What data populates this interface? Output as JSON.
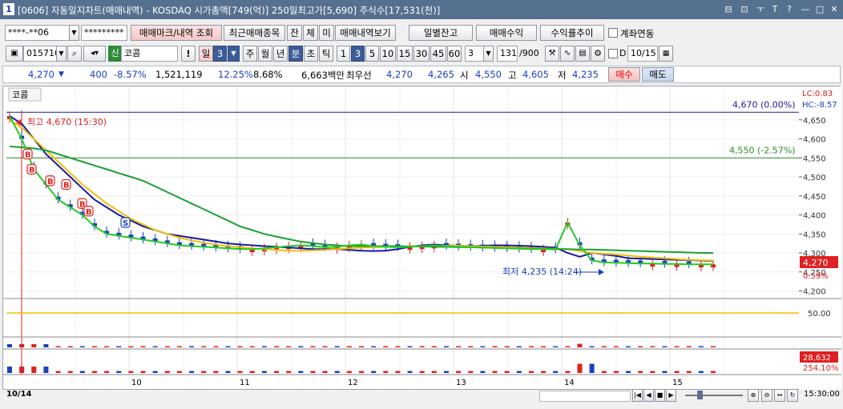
{
  "window": {
    "number": "1",
    "title": "[0606] 자동일지차트(매매내역) - KOSDAQ 시가총액[749(억)] 250일최고가[5,690] 주식수[17,531(천)]",
    "controls": [
      "⊟",
      "⊡",
      "ㅜ",
      "T",
      "?",
      "—",
      "□",
      "✕"
    ]
  },
  "toolbar1": {
    "account": "****-**06",
    "password": "*********",
    "buttons": {
      "trade_mark": "매매마크/내역 조회",
      "recent_items": "최근매매종목",
      "balance": "잔",
      "execution": "체",
      "unfilled": "미",
      "trade_history": "매매내역보기",
      "daily_balance": "일별잔고",
      "trade_profit": "매매수익",
      "return_trend": "수익률추이"
    },
    "account_link_label": "계좌연동"
  },
  "toolbar2": {
    "code": "015710",
    "market_tag": "신",
    "stock_name": "코콤",
    "period_unit": "일",
    "period_value": "3",
    "periods": [
      "주",
      "월",
      "년",
      "분",
      "초",
      "틱"
    ],
    "intervals": [
      "1",
      "3",
      "5",
      "10",
      "15",
      "30",
      "45",
      "60"
    ],
    "interval_value": "3",
    "count_current": "131",
    "count_total": "/900",
    "d_label": "D",
    "date": "10/15"
  },
  "quote": {
    "price": "4,270",
    "change": "400",
    "change_pct": "-8.57%",
    "volume": "1,521,119",
    "turnover_pct": "12.25%",
    "pct2": "8.68%",
    "amount": "6,663백만",
    "best_label": "최우선",
    "ask": "4,270",
    "bid": "4,265",
    "open_label": "시",
    "open": "4,550",
    "high_label": "고",
    "high": "4,605",
    "low_label": "저",
    "low": "4,235",
    "buy": "매수",
    "sell": "매도"
  },
  "chart_data": {
    "type": "line",
    "legend": "코콤",
    "ylim": [
      4180,
      4700
    ],
    "y_ticks": [
      "4,650",
      "4,600",
      "4,550",
      "4,500",
      "4,450",
      "4,400",
      "4,350",
      "4,300",
      "4,250",
      "4,200"
    ],
    "x_labels": [
      "10/14",
      "10",
      "11",
      "12",
      "13",
      "14",
      "15"
    ],
    "lc": "LC:0.83",
    "hc": "HC:-8.57",
    "hline_top": {
      "value": 4670,
      "label": "4,670 (0.00%)"
    },
    "hline_mid": {
      "value": 4550,
      "label": "4,550 (-2.57%)"
    },
    "high_annotation": "최고 4,670 (15:30)",
    "low_annotation": "최저 4,235 (14:24)",
    "current_price": "4,270",
    "current_pct": "0.59%",
    "osc_label": "50.00",
    "volume_label": "28,632",
    "volume_pct": "254.10%",
    "time_label": "15:30:00",
    "trade_marks": [
      "B",
      "B",
      "B",
      "B",
      "B",
      "B",
      "S"
    ],
    "series": [
      {
        "color": "#1818a8",
        "values": [
          4660,
          4640,
          4600,
          4560,
          4530,
          4500,
          4470,
          4440,
          4420,
          4400,
          4385,
          4370,
          4360,
          4350,
          4345,
          4340,
          4335,
          4330,
          4325,
          4322,
          4320,
          4318,
          4316,
          4314,
          4312,
          4310,
          4310,
          4310,
          4308,
          4306,
          4305,
          4306,
          4310,
          4316,
          4320,
          4322,
          4320,
          4319,
          4318,
          4319,
          4320,
          4320,
          4319,
          4318,
          4316,
          4314,
          4300,
          4290,
          4300,
          4296,
          4292,
          4286,
          4285,
          4284,
          4283,
          4282,
          4281,
          4280,
          4279
        ]
      },
      {
        "color": "#f0c000",
        "values": [
          4650,
          4630,
          4600,
          4570,
          4540,
          4510,
          4480,
          4455,
          4430,
          4410,
          4390,
          4375,
          4360,
          4350,
          4340,
          4333,
          4327,
          4322,
          4318,
          4315,
          4312,
          4310,
          4308,
          4306,
          4306,
          4307,
          4308,
          4310,
          4312,
          4314,
          4315,
          4316,
          4317,
          4318,
          4318,
          4318,
          4319,
          4319,
          4318,
          4317,
          4316,
          4315,
          4314,
          4313,
          4312,
          4311,
          4310,
          4305,
          4300,
          4298,
          4296,
          4293,
          4290,
          4288,
          4286,
          4284,
          4282,
          4281,
          4280
        ]
      },
      {
        "color": "#1aa030",
        "values": [
          4580,
          4578,
          4575,
          4570,
          4560,
          4550,
          4540,
          4530,
          4520,
          4510,
          4500,
          4490,
          4475,
          4460,
          4445,
          4430,
          4415,
          4400,
          4385,
          4370,
          4360,
          4350,
          4343,
          4336,
          4330,
          4326,
          4322,
          4320,
          4318,
          4318,
          4318,
          4318,
          4318,
          4317,
          4317,
          4316,
          4316,
          4315,
          4315,
          4314,
          4313,
          4312,
          4312,
          4311,
          4311,
          4310,
          4310,
          4309,
          4309,
          4308,
          4307,
          4306,
          4305,
          4304,
          4303,
          4302,
          4301,
          4300,
          4300
        ]
      }
    ],
    "fast_series": {
      "color": "#22cc22",
      "values": [
        4660,
        4600,
        4520,
        4480,
        4440,
        4420,
        4400,
        4370,
        4350,
        4345,
        4340,
        4335,
        4330,
        4325,
        4320,
        4318,
        4316,
        4314,
        4312,
        4310,
        4310,
        4312,
        4315,
        4318,
        4320,
        4318,
        4315,
        4316,
        4320,
        4322,
        4318,
        4316,
        4315,
        4316,
        4318,
        4320,
        4318,
        4316,
        4315,
        4314,
        4313,
        4312,
        4311,
        4310,
        4310,
        4309,
        4380,
        4320,
        4280,
        4275,
        4274,
        4273,
        4272,
        4272,
        4271,
        4271,
        4270,
        4270,
        4270
      ]
    }
  }
}
